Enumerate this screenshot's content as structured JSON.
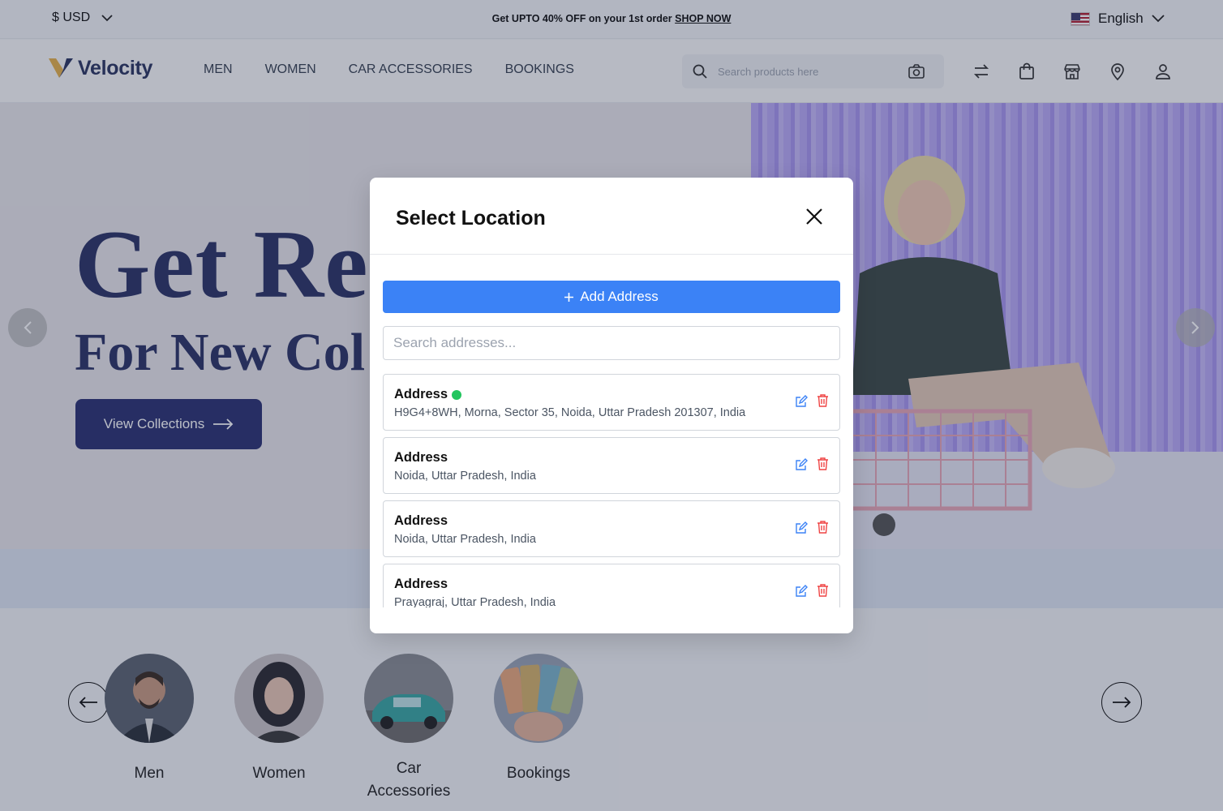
{
  "topbar": {
    "currency": "$ USD",
    "promo_text": "Get UPTO 40% OFF on your 1st order ",
    "promo_link": "SHOP NOW",
    "language": "English"
  },
  "header": {
    "logo_text": "Velocity",
    "nav": [
      "MEN",
      "WOMEN",
      "CAR ACCESSORIES",
      "BOOKINGS"
    ],
    "search_placeholder": "Search products here"
  },
  "hero": {
    "title_line1": "Get Re",
    "title_line2": "For New Col",
    "button_label": "View Collections"
  },
  "categories": [
    {
      "label": "Men"
    },
    {
      "label": "Women"
    },
    {
      "label": "Car Accessories"
    },
    {
      "label": "Bookings"
    }
  ],
  "modal": {
    "title": "Select Location",
    "add_button": "Add Address",
    "search_placeholder": "Search addresses...",
    "addresses": [
      {
        "name": "Address",
        "line": "H9G4+8WH, Morna, Sector 35, Noida, Uttar Pradesh 201307, India",
        "active": true
      },
      {
        "name": "Address",
        "line": "Noida, Uttar Pradesh, India",
        "active": false
      },
      {
        "name": "Address",
        "line": "Noida, Uttar Pradesh, India",
        "active": false
      },
      {
        "name": "Address",
        "line": "Prayagraj, Uttar Pradesh, India",
        "active": false
      }
    ]
  },
  "colors": {
    "accent": "#3b82f6",
    "brand": "#2c3560",
    "active_dot": "#22c55e",
    "delete": "#ef4444"
  }
}
